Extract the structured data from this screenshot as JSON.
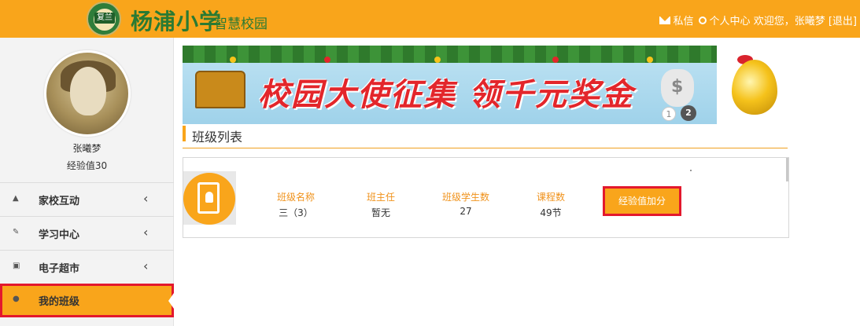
{
  "header": {
    "logo_tag": "复兰",
    "school_name": "杨浦小学",
    "school_sub": "智慧校园",
    "messages_label": "私信",
    "personal_center_label": "个人中心",
    "welcome_text": "欢迎您，张曦梦",
    "logout_label": "[退出]",
    "colors": {
      "bar": "#f9a51b",
      "logo_green": "#2a7a33"
    }
  },
  "sidebar": {
    "user_name": "张曦梦",
    "exp_text": "经验值30",
    "items": [
      {
        "label": "家校互动",
        "icon": "home-icon"
      },
      {
        "label": "学习中心",
        "icon": "edit-icon"
      },
      {
        "label": "电子超市",
        "icon": "cart-icon"
      },
      {
        "label": "我的班级",
        "icon": "user-icon",
        "active": true
      }
    ]
  },
  "banner": {
    "headline": "校园大使征集  领千元奖金",
    "slide_1": "1",
    "slide_2": "2"
  },
  "main": {
    "section_title": "班级列表",
    "class_card": {
      "columns": [
        {
          "header": "班级名称",
          "value": "三（3）"
        },
        {
          "header": "班主任",
          "value": "暂无"
        },
        {
          "header": "班级学生数",
          "value": "27"
        },
        {
          "header": "课程数",
          "value": "49节"
        }
      ],
      "exp_button_label": "经验值加分"
    }
  }
}
